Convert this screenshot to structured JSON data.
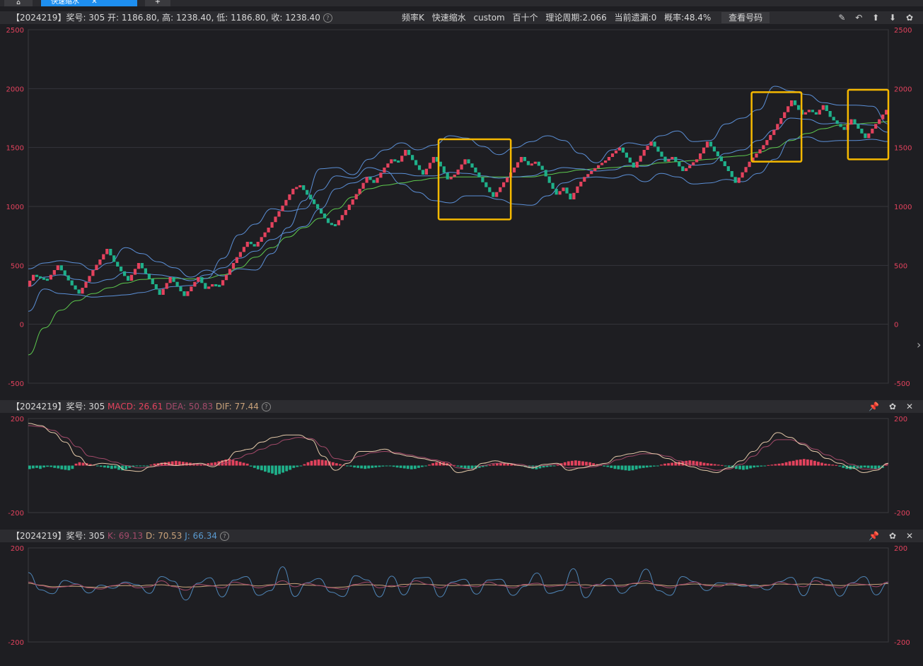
{
  "tabs": {
    "home_icon": "home-icon",
    "active_label": "快速缩水",
    "active_close": "✕",
    "add_label": "+"
  },
  "main_panel": {
    "info": "【2024219】奖号: 305  开: 1186.80, 高: 1238.40, 低: 1186.80, 收: 1238.40",
    "help": "?",
    "toolbar": [
      "频率K",
      "快速缩水",
      "custom",
      "百十个",
      "理论周期:2.066",
      "当前遗漏:0",
      "概率:48.4%"
    ],
    "view_button": "查看号码",
    "icons": [
      "edit-icon",
      "back-icon",
      "up-icon",
      "down-icon",
      "settings-icon"
    ],
    "y_ticks": [
      "2500",
      "2000",
      "1500",
      "1000",
      "500",
      "0",
      "-500"
    ]
  },
  "macd_panel": {
    "prefix": "【2024219】奖号: 305",
    "macd": "MACD: 26.61",
    "dea": "DEA: 50.83",
    "dif": "DIF: 77.44",
    "help": "?",
    "y_ticks": [
      "200",
      "-200"
    ],
    "icons": [
      "pin-icon",
      "settings-icon",
      "close-icon"
    ]
  },
  "kdj_panel": {
    "prefix": "【2024219】奖号: 305",
    "k": "K: 69.13",
    "d": "D: 70.53",
    "j": "J: 66.34",
    "help": "?",
    "y_ticks": [
      "200",
      "-200"
    ],
    "icons": [
      "pin-icon",
      "settings-icon",
      "close-icon"
    ]
  },
  "colors": {
    "up": "#e3425d",
    "down": "#1fb08a",
    "band": "#5b8fd6",
    "ma": "#5dc94e",
    "dif": "#e3c8a8",
    "dea": "#a34a6a",
    "highlight": "#f5b800"
  },
  "chart_data": {
    "type": "line",
    "main": {
      "ylim": [
        -500,
        2500
      ],
      "close_path": [
        320,
        420,
        395,
        380,
        500,
        330,
        260,
        460,
        640,
        530,
        370,
        520,
        250,
        400,
        240,
        400,
        300,
        340,
        330,
        420,
        570,
        700,
        660,
        820,
        960,
        1150,
        1180,
        1020,
        860,
        840,
        970,
        1150,
        1250,
        1200,
        1330,
        1400,
        1380,
        1480,
        1350,
        1270,
        1420,
        1340,
        1230,
        1270,
        1400,
        1330,
        1080,
        1330,
        1420,
        1350,
        1380,
        1310,
        1200,
        1100,
        1160,
        1060,
        1170,
        1250,
        1300,
        1350,
        1390,
        1450,
        1500,
        1330,
        1480,
        1550,
        1380,
        1420,
        1300,
        1350,
        1400,
        1550,
        1300,
        1200,
        1380,
        1450,
        1520,
        1650,
        1800,
        1900,
        1780,
        1820,
        1780,
        1860,
        1760,
        1700,
        1650,
        1740,
        1580,
        1700,
        1820
      ],
      "upper_band": [
        470,
        520,
        540,
        520,
        460,
        520,
        650,
        600,
        530,
        480,
        400,
        460,
        410,
        470,
        460,
        600,
        820,
        1050,
        1320,
        1330,
        1270,
        1400,
        1480,
        1540,
        1480,
        1520,
        1600,
        1580,
        1510,
        1440,
        1500,
        1550,
        1600,
        1560,
        1450,
        1370,
        1480,
        1540,
        1520,
        1600,
        1640,
        1550,
        1560,
        1700,
        1750,
        1820,
        2020,
        1980,
        1950,
        1880,
        1860,
        1860,
        1850,
        1700
      ],
      "lower_band": [
        110,
        300,
        260,
        250,
        230,
        240,
        250,
        270,
        300,
        320,
        330,
        390,
        560,
        760,
        850,
        980,
        960,
        980,
        1140,
        1260,
        1240,
        1330,
        1300,
        1190,
        1120,
        1050,
        1030,
        1090,
        1090,
        1060,
        1020,
        1010,
        1090,
        1200,
        1240,
        1250,
        1240,
        1270,
        1210,
        1280,
        1250,
        1190,
        1200,
        1230,
        1210,
        1280,
        1400,
        1570,
        1590,
        1550,
        1560,
        1560,
        1570,
        1550
      ],
      "mid_band": [
        320,
        400,
        420,
        380,
        350,
        380,
        440,
        430,
        420,
        400,
        370,
        420,
        480,
        560,
        620,
        720,
        780,
        830,
        980,
        1150,
        1200,
        1250,
        1280,
        1280,
        1260,
        1260,
        1290,
        1280,
        1260,
        1240,
        1250,
        1260,
        1300,
        1330,
        1320,
        1300,
        1310,
        1350,
        1340,
        1400,
        1400,
        1350,
        1360,
        1450,
        1480,
        1560,
        1650,
        1750,
        1740,
        1700,
        1710,
        1700,
        1690,
        1630
      ],
      "ma_line": [
        -260,
        -30,
        120,
        200,
        260,
        310,
        350,
        380,
        390,
        390,
        385,
        390,
        420,
        480,
        570,
        650,
        740,
        820,
        900,
        980,
        1080,
        1150,
        1180,
        1200,
        1220,
        1240,
        1250,
        1250,
        1250,
        1250,
        1250,
        1250,
        1270,
        1290,
        1310,
        1320,
        1330,
        1340,
        1350,
        1370,
        1380,
        1390,
        1400,
        1420,
        1430,
        1460,
        1500,
        1560,
        1620,
        1660,
        1690,
        1700,
        1710,
        1720
      ],
      "highlights": [
        {
          "from_index": 0.477,
          "to_index": 0.561,
          "y_top": 1570,
          "y_bottom": 890
        },
        {
          "from_index": 0.841,
          "to_index": 0.899,
          "y_top": 1970,
          "y_bottom": 1380
        },
        {
          "from_index": 0.953,
          "to_index": 1.0,
          "y_top": 1990,
          "y_bottom": 1400
        }
      ]
    },
    "macd": {
      "ylim": [
        -200,
        200
      ],
      "dif": [
        180,
        170,
        140,
        100,
        40,
        0,
        10,
        5,
        -20,
        -25,
        -5,
        10,
        0,
        5,
        10,
        -5,
        20,
        60,
        70,
        100,
        120,
        130,
        130,
        110,
        40,
        -20,
        10,
        60,
        60,
        70,
        50,
        40,
        30,
        20,
        5,
        -30,
        -20,
        10,
        20,
        10,
        0,
        -10,
        5,
        10,
        -20,
        -10,
        0,
        10,
        40,
        50,
        60,
        50,
        30,
        10,
        -5,
        -20,
        -30,
        -10,
        20,
        60,
        100,
        140,
        120,
        90,
        60,
        30,
        10,
        -10,
        -30,
        -20,
        10
      ],
      "dea": [
        170,
        165,
        150,
        120,
        80,
        40,
        30,
        15,
        0,
        -10,
        -5,
        0,
        0,
        5,
        5,
        0,
        10,
        30,
        50,
        70,
        90,
        110,
        120,
        115,
        80,
        30,
        20,
        40,
        55,
        60,
        55,
        45,
        35,
        25,
        15,
        -10,
        -15,
        0,
        10,
        10,
        5,
        -5,
        0,
        5,
        -10,
        -10,
        -5,
        5,
        25,
        40,
        50,
        50,
        40,
        20,
        5,
        -10,
        -20,
        -15,
        5,
        40,
        80,
        110,
        110,
        95,
        70,
        45,
        25,
        5,
        -15,
        -15,
        5
      ],
      "hist_seed": [
        -15,
        -12,
        -10,
        -14,
        -8,
        -5,
        -6,
        -10,
        -12,
        -16,
        -18,
        -20,
        -14,
        8,
        14,
        12,
        10,
        6,
        4,
        -2,
        -5,
        -8,
        -10,
        -14,
        -12,
        -18,
        -20,
        -16,
        -10,
        -6,
        -3,
        -2,
        -1,
        -2,
        4,
        8,
        10,
        12,
        14,
        16,
        18,
        20,
        18,
        16,
        14,
        12,
        10,
        8,
        6,
        8,
        10,
        12,
        14,
        18,
        22,
        26,
        28,
        24,
        20,
        16,
        12,
        8,
        -4,
        -10,
        -16,
        -20,
        -26,
        -30,
        -34,
        -40,
        -36,
        -30,
        -24,
        -18,
        -10,
        -6,
        -3,
        6,
        14,
        20,
        24,
        26,
        24,
        22,
        18,
        14,
        10,
        6,
        2,
        -2,
        -4,
        -8,
        -10,
        -12,
        -14,
        -12,
        -10,
        -8,
        -6,
        -4,
        -2,
        -3,
        -5,
        -8,
        -10,
        -12,
        -14,
        -16,
        -14,
        -10,
        -6,
        -2,
        4,
        10,
        14,
        16,
        14,
        10,
        6,
        2,
        -4,
        -8,
        -12,
        -14,
        -16,
        -14,
        -10,
        -6,
        -2,
        2,
        6,
        10,
        12,
        10,
        8,
        6,
        4,
        2,
        -2,
        -6,
        -10,
        -14,
        -16,
        -12,
        -8,
        -6,
        -4,
        -2,
        4,
        10,
        14,
        18,
        20,
        22,
        20,
        18,
        16,
        14,
        10,
        6,
        2,
        -4,
        -6,
        -10,
        -14,
        -16,
        -18,
        -20,
        -22,
        -20,
        -16,
        -12,
        -10,
        -8,
        -6,
        -4,
        -2,
        4,
        8,
        10,
        12,
        14,
        16,
        18,
        20,
        22,
        20,
        18,
        16,
        12,
        10,
        8,
        6,
        4,
        2,
        -2,
        -6,
        -10,
        -14,
        -16,
        -18,
        -16,
        -12,
        -8,
        -6,
        -4,
        -2,
        2,
        4,
        6,
        8,
        10,
        14,
        18,
        20,
        24,
        26,
        28,
        26,
        24,
        20,
        16,
        12,
        8,
        6,
        4,
        2,
        -4,
        -10,
        -14,
        -16,
        -14,
        -12,
        -10,
        -8,
        -10,
        -12,
        -14,
        -12,
        -10,
        8
      ]
    },
    "kdj": {
      "ylim": [
        -200,
        200
      ],
      "k": [
        55,
        40,
        30,
        35,
        45,
        30,
        25,
        40,
        50,
        30,
        35,
        60,
        35,
        20,
        45,
        40,
        30,
        55,
        45,
        30,
        40,
        60,
        35,
        50,
        40,
        30,
        25,
        45,
        55,
        30,
        40,
        35,
        60,
        45,
        30,
        50,
        40,
        35,
        55,
        40,
        30,
        45,
        50,
        35,
        40,
        55,
        30,
        45,
        40,
        35,
        50,
        60,
        40,
        30,
        45,
        55,
        40,
        35,
        50,
        45,
        30,
        40,
        55,
        45,
        35,
        60,
        40,
        30,
        50,
        45,
        35,
        55
      ]
    }
  }
}
